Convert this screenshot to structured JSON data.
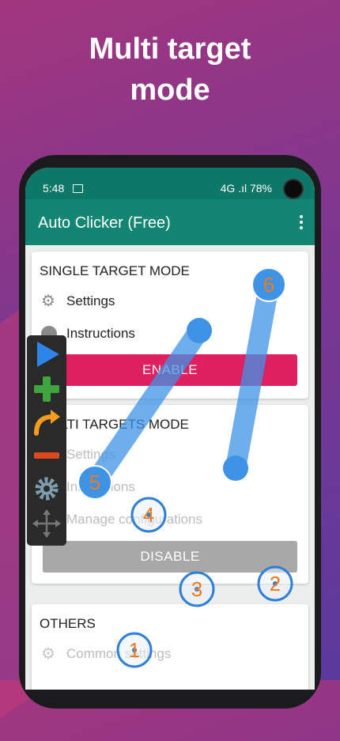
{
  "headline": {
    "line1": "Multi target",
    "line2": "mode"
  },
  "status": {
    "time": "5:48",
    "right": "4G .ıl 78%"
  },
  "appbar": {
    "title": "Auto Clicker (Free)"
  },
  "single": {
    "title": "SINGLE TARGET MODE",
    "settings": "Settings",
    "instructions": "Instructions",
    "button": "ENABLE"
  },
  "multi": {
    "title": "MULTI TARGETS MODE",
    "settings": "Settings",
    "instructions": "Instructions",
    "manage": "Manage configurations",
    "button": "DISABLE"
  },
  "others": {
    "title": "OTHERS",
    "common": "Common settings"
  },
  "targets": [
    "1",
    "2",
    "3",
    "4",
    "5",
    "6"
  ],
  "toolbar": {
    "icons": [
      "play-icon",
      "add-icon",
      "swipe-icon",
      "remove-icon",
      "gear-icon",
      "move-icon"
    ]
  },
  "colors": {
    "appbar": "#138573",
    "statusbar": "#0e7868",
    "enable": "#de2060",
    "disable": "#a8a8a8",
    "target": "#3f93e6",
    "toolbar": "#2a2a2a"
  }
}
